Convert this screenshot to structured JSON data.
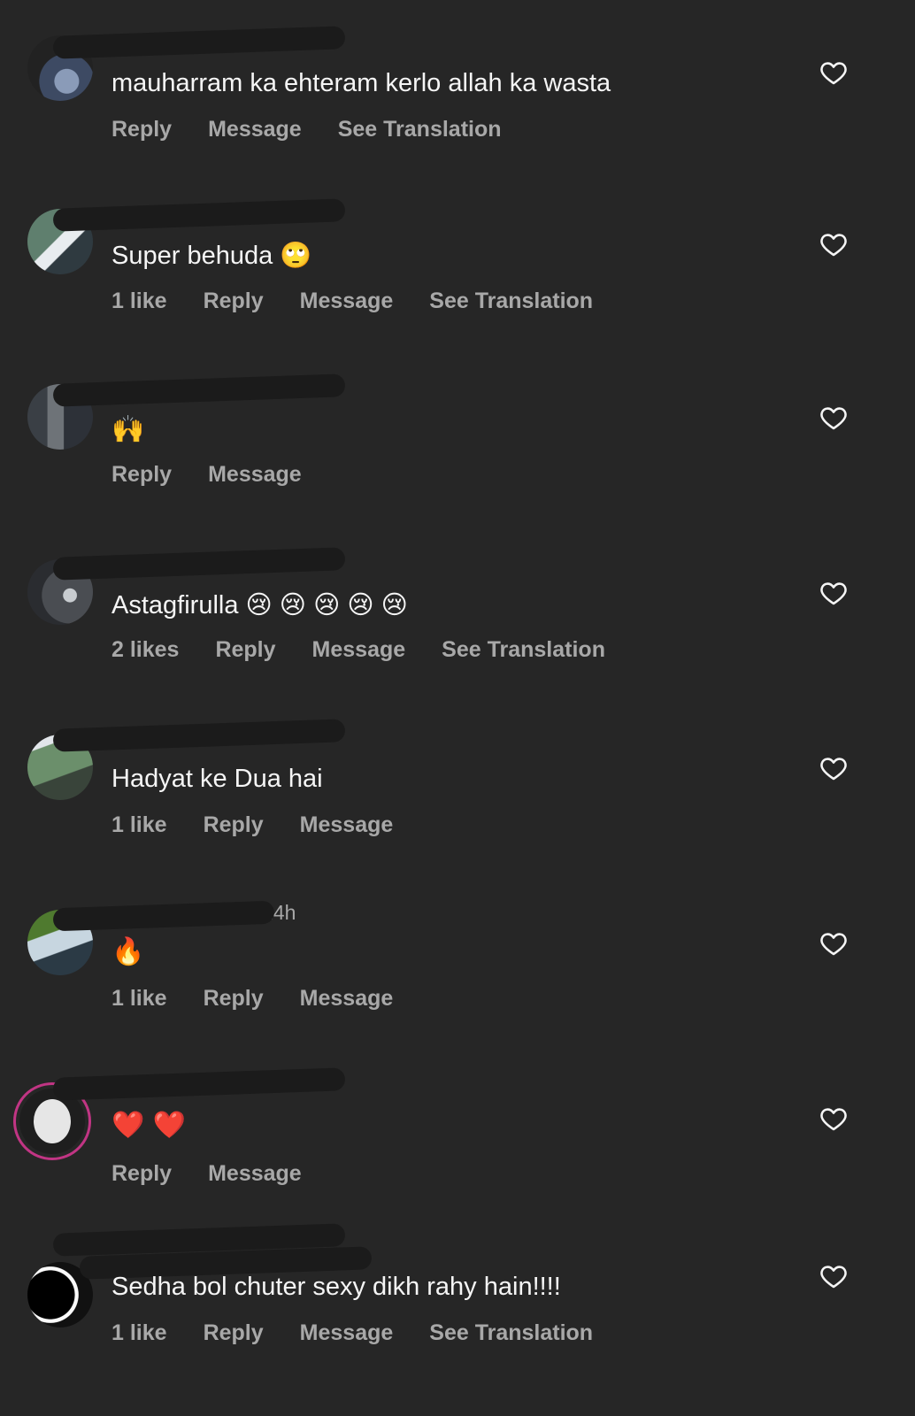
{
  "colors": {
    "background": "#262626",
    "primary_text": "#f5f5f5",
    "secondary_text": "#a8a8a8",
    "story_ring": "#c13584"
  },
  "icons": {
    "like": "heart-outline-icon"
  },
  "comments": [
    {
      "username": "",
      "time": "",
      "text": "mauharram ka ehteram kerlo allah ka wasta",
      "likes": "",
      "reply": "Reply",
      "message": "Message",
      "see_translation": "See Translation"
    },
    {
      "username": "",
      "time": "",
      "text": "Super behuda 🙄",
      "likes": "1 like",
      "reply": "Reply",
      "message": "Message",
      "see_translation": "See Translation"
    },
    {
      "username": "",
      "time": "",
      "text": "🙌",
      "likes": "",
      "reply": "Reply",
      "message": "Message",
      "see_translation": ""
    },
    {
      "username": "",
      "time": "",
      "text": "Astagfirulla 😢 😢 😢 😢 😢",
      "likes": "2 likes",
      "reply": "Reply",
      "message": "Message",
      "see_translation": "See Translation"
    },
    {
      "username": "",
      "time": "",
      "text": "Hadyat ke Dua hai",
      "likes": "1 like",
      "reply": "Reply",
      "message": "Message",
      "see_translation": ""
    },
    {
      "username": "",
      "time": "14h",
      "text": "🔥",
      "likes": "1 like",
      "reply": "Reply",
      "message": "Message",
      "see_translation": ""
    },
    {
      "username": "",
      "time": "",
      "text": "❤️ ❤️",
      "likes": "",
      "reply": "Reply",
      "message": "Message",
      "see_translation": ""
    },
    {
      "username": "",
      "time": "",
      "text": "Sedha bol chuter sexy dikh rahy hain!!!!",
      "likes": "1 like",
      "reply": "Reply",
      "message": "Message",
      "see_translation": "See Translation"
    }
  ]
}
